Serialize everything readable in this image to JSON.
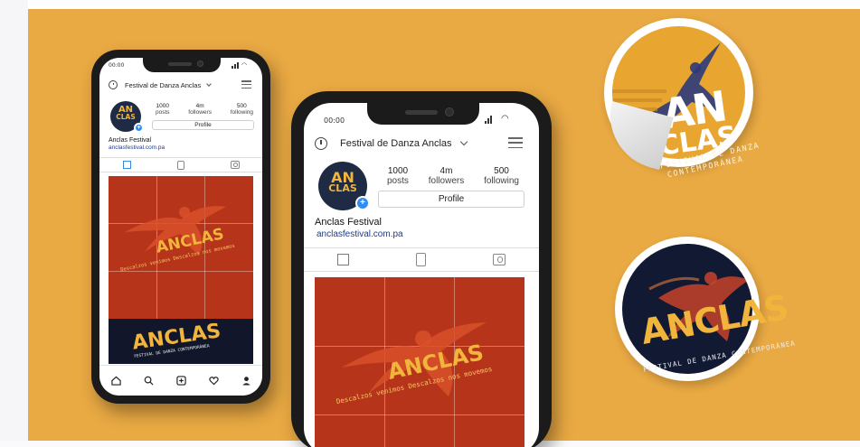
{
  "colors": {
    "background": "#e9a943",
    "post_red": "#b6351a",
    "navy": "#121933",
    "accent_yellow": "#f2b53c",
    "link_blue": "#1f3b86",
    "plus_blue": "#2f8cf2"
  },
  "phones": [
    {
      "status_time": "00:00",
      "account_title": "Festival de Danza Anclas",
      "avatar_logo_top": "AN",
      "avatar_logo_bottom": "CLAS",
      "avatar_plus": "+",
      "stats": [
        {
          "value": "1000",
          "label": "posts"
        },
        {
          "value": "4m",
          "label": "followers"
        },
        {
          "value": "500",
          "label": "following"
        }
      ],
      "profile_button": "Profile",
      "display_name": "Anclas Festival",
      "website": "anclasfestival.com.pa",
      "post_title": "ANCLAS",
      "post_subtitle": "Descalzos venimos Descalzos nos movemos",
      "post2_title": "ANCLAS",
      "post2_subtitle": "FESTIVAL DE DANZA CONTEMPORÁNEA",
      "bottom_nav_icons": [
        "home-icon",
        "search-icon",
        "add-post-icon",
        "heart-icon",
        "profile-icon"
      ]
    },
    {
      "status_time": "00:00",
      "account_title": "Festival de Danza Anclas",
      "avatar_logo_top": "AN",
      "avatar_logo_bottom": "CLAS",
      "avatar_plus": "+",
      "stats": [
        {
          "value": "1000",
          "label": "posts"
        },
        {
          "value": "4m",
          "label": "followers"
        },
        {
          "value": "500",
          "label": "following"
        }
      ],
      "profile_button": "Profile",
      "display_name": "Anclas Festival",
      "website": "anclasfestival.com.pa",
      "post_title": "ANCLAS",
      "post_subtitle": "Descalzos venimos Descalzos nos movemos"
    }
  ],
  "stickers": [
    {
      "title_top": "AN",
      "title_bottom": "CLAS",
      "subtitle_line1": "FESTIVAL DE DANZA",
      "subtitle_line2": "CONTEMPORÁNEA"
    },
    {
      "title": "ANCLAS",
      "subtitle": "FESTIVAL DE DANZA CONTEMPORÁNEA"
    }
  ]
}
